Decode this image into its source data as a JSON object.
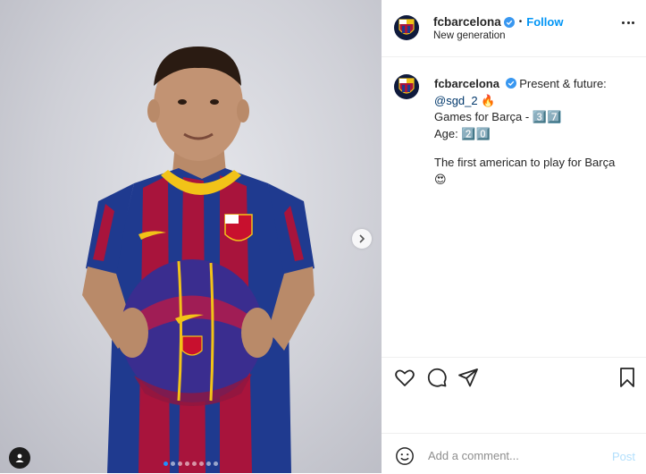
{
  "colors": {
    "accent": "#0095f6",
    "verified": "#3897f0",
    "kit_blue": "#1f3a8f",
    "kit_red": "#a8143c",
    "kit_gold": "#f2c318"
  },
  "post": {
    "username": "fcbarcelona",
    "verified": true,
    "follow_label": "Follow",
    "separator": "•",
    "location": "New generation",
    "more_icon": "more-options-icon"
  },
  "caption": {
    "username": "fcbarcelona",
    "line1": "Present & future:",
    "mention": "@sgd_2",
    "mention_emoji": "🔥",
    "line_games": "Games for Barça - 3️⃣7️⃣",
    "line_age": "Age: 2️⃣0️⃣",
    "line_first": "The first american to play for Barça",
    "final_emoji": "😍"
  },
  "actions": {
    "like_icon": "heart-icon",
    "comment_icon": "comment-icon",
    "share_icon": "share-icon",
    "save_icon": "bookmark-icon"
  },
  "comment_box": {
    "placeholder": "Add a comment...",
    "post_label": "Post",
    "emoji_icon": "emoji-icon"
  },
  "carousel": {
    "count": 8,
    "active_index": 0
  }
}
